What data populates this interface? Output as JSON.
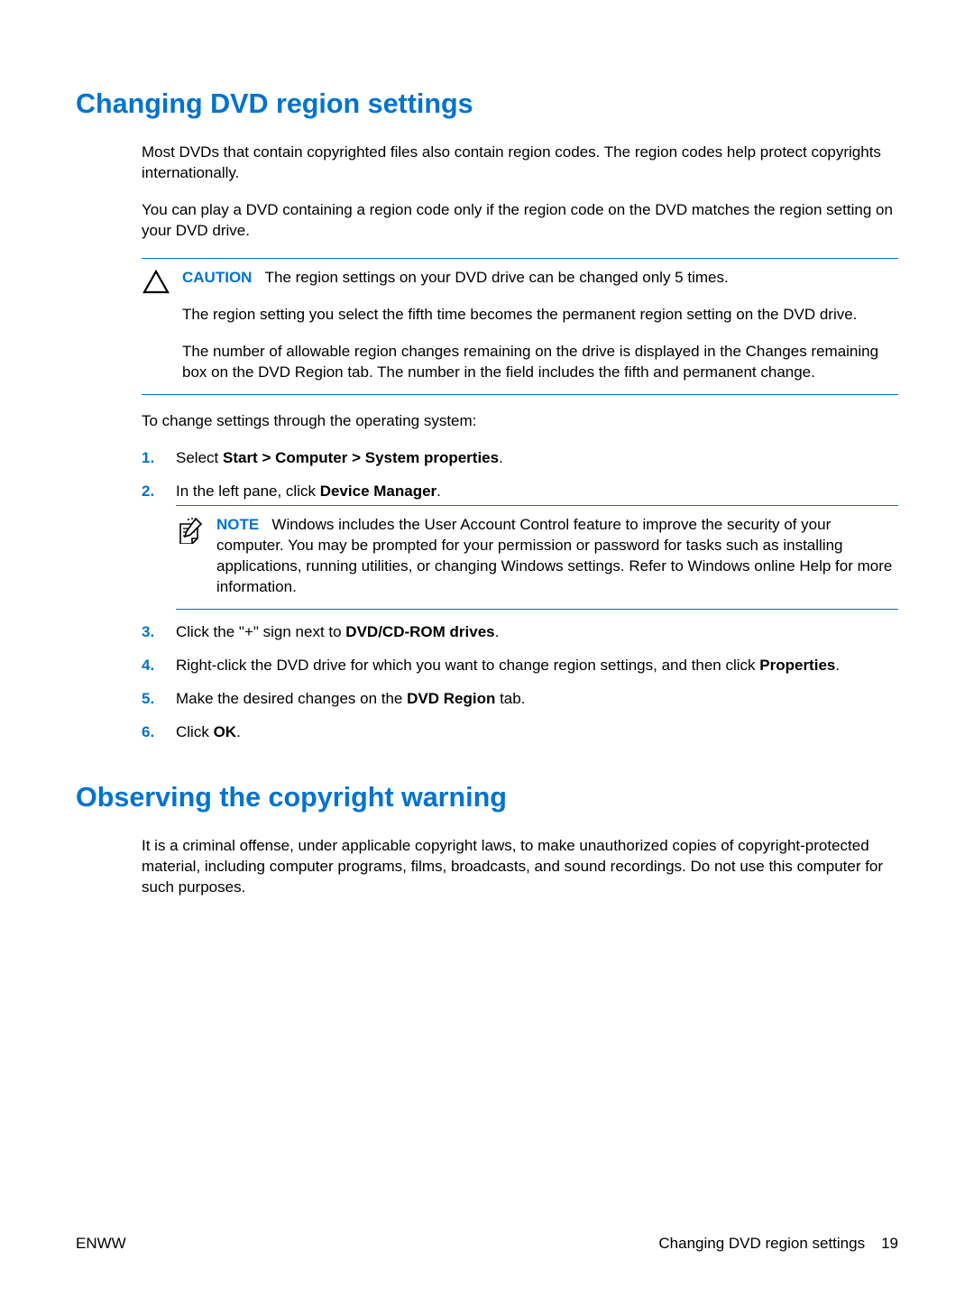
{
  "section1": {
    "heading": "Changing DVD region settings",
    "para1": "Most DVDs that contain copyrighted files also contain region codes. The region codes help protect copyrights internationally.",
    "para2": "You can play a DVD containing a region code only if the region code on the DVD matches the region setting on your DVD drive.",
    "caution": {
      "label": "CAUTION",
      "text1": "The region settings on your DVD drive can be changed only 5 times.",
      "text2": "The region setting you select the fifth time becomes the permanent region setting on the DVD drive.",
      "text3": "The number of allowable region changes remaining on the drive is displayed in the Changes remaining box on the DVD Region tab. The number in the field includes the fifth and permanent change."
    },
    "para3": "To change settings through the operating system:",
    "steps": {
      "s1": {
        "pre": "Select ",
        "bold": "Start > Computer > System properties",
        "post": "."
      },
      "s2": {
        "pre": "In the left pane, click ",
        "bold": "Device Manager",
        "post": "."
      },
      "note": {
        "label": "NOTE",
        "text": "Windows includes the User Account Control feature to improve the security of your computer. You may be prompted for your permission or password for tasks such as installing applications, running utilities, or changing Windows settings. Refer to Windows online Help for more information."
      },
      "s3": {
        "pre": "Click the \"+\" sign next to ",
        "bold": "DVD/CD-ROM drives",
        "post": "."
      },
      "s4": {
        "pre": "Right-click the DVD drive for which you want to change region settings, and then click ",
        "bold": "Properties",
        "post": "."
      },
      "s5": {
        "pre": "Make the desired changes on the ",
        "bold": "DVD Region",
        "post": " tab."
      },
      "s6": {
        "pre": "Click ",
        "bold": "OK",
        "post": "."
      }
    }
  },
  "section2": {
    "heading": "Observing the copyright warning",
    "para1": "It is a criminal offense, under applicable copyright laws, to make unauthorized copies of copyright-protected material, including computer programs, films, broadcasts, and sound recordings. Do not use this computer for such purposes."
  },
  "footer": {
    "left": "ENWW",
    "rightText": "Changing DVD region settings",
    "pageNum": "19"
  }
}
